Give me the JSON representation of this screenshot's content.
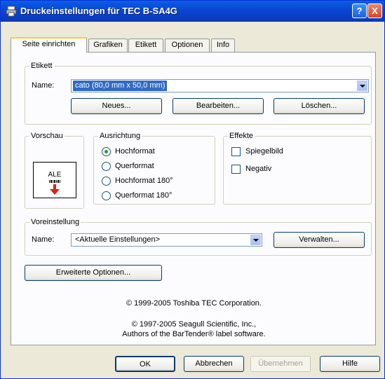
{
  "window": {
    "title": "Druckeinstellungen für TEC B-SA4G"
  },
  "tabs": [
    {
      "label": "Seite einrichten"
    },
    {
      "label": "Grafiken"
    },
    {
      "label": "Etikett"
    },
    {
      "label": "Optionen"
    },
    {
      "label": "Info"
    }
  ],
  "etikett": {
    "group_label": "Etikett",
    "name_label": "Name:",
    "name_value": "cato (80,0 mm x 50,0 mm)",
    "new_button": "Neues...",
    "edit_button": "Bearbeiten...",
    "delete_button": "Löschen..."
  },
  "vorschau": {
    "group_label": "Vorschau",
    "preview_text": "ALE"
  },
  "ausrichtung": {
    "group_label": "Ausrichtung",
    "options": [
      {
        "label": "Hochformat",
        "checked": true
      },
      {
        "label": "Querformat",
        "checked": false
      },
      {
        "label": "Hochformat 180°",
        "checked": false
      },
      {
        "label": "Querformat 180°",
        "checked": false
      }
    ]
  },
  "effekte": {
    "group_label": "Effekte",
    "options": [
      {
        "label": "Spiegelbild",
        "checked": false
      },
      {
        "label": "Negativ",
        "checked": false
      }
    ]
  },
  "voreinstellung": {
    "group_label": "Voreinstellung",
    "name_label": "Name:",
    "name_value": "<Aktuelle Einstellungen>",
    "manage_button": "Verwalten..."
  },
  "advanced_button": "Erweiterte Optionen...",
  "copyright": {
    "line1": "© 1999-2005 Toshiba TEC Corporation.",
    "line2": "© 1997-2005 Seagull Scientific, Inc.,",
    "line3": "Authors of the BarTender® label software."
  },
  "buttons": {
    "ok": "OK",
    "cancel": "Abbrechen",
    "apply": "Übernehmen",
    "help": "Hilfe"
  },
  "titlebar_buttons": {
    "help": "?",
    "close": "X"
  },
  "colors": {
    "accent": "#316ac5",
    "titlebar": "#0a48d2",
    "arrow": "#e02010"
  }
}
